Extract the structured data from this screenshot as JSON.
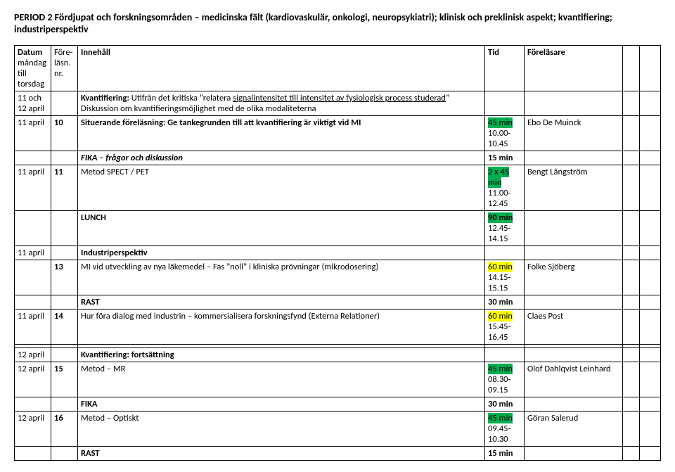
{
  "title": "PERIOD 2 Fördjupat och forskningsområden – medicinska fält (kardiovaskulär, onkologi, neuropsykiatri); klinisk och preklinisk aspekt; kvantifiering; industriperspektiv",
  "head": {
    "datum": "Datum",
    "datum_sub": "måndag till torsdag",
    "nr": "Före-läsn. nr.",
    "innehall": "Innehåll",
    "tid": "Tid",
    "forelasare": "Föreläsare"
  },
  "rows": {
    "r1_date": "11 och 12 april",
    "r1_text_a": "Kvantifiering:",
    "r1_text_b": " Utifrån det kritiska ”relatera ",
    "r1_text_underline": "signalintensitet till intensitet av fysiologisk process studerad",
    "r1_text_c": "” Diskussion om kvantifieringsmöjlighet med de olika modaliteterna",
    "r2_date": "11 april",
    "r2_nr": "10",
    "r2_text": "Situerande föreläsning: Ge tankegrunden till att kvantifiering är viktigt vid MI",
    "r2_tid1": "45 min",
    "r2_tid2": "10.00-10.45",
    "r2_fore": "Ebo De Muinck",
    "r3_text": "FIKA – frågor och diskussion",
    "r3_tid": "15 min",
    "r4_date": "11 april",
    "r4_nr": "11",
    "r4_text": "Metod SPECT / PET",
    "r4_tid1": "2 x 45 min",
    "r4_tid2": "11.00-12.45",
    "r4_fore": "Bengt Långström",
    "r5_text": "LUNCH",
    "r5_tid1": "90 min",
    "r5_tid2": "12.45-14.15",
    "r6_date": "11 april",
    "r6_text": "Industriperspektiv",
    "r7_nr": "13",
    "r7_text": "MI vid utveckling av nya läkemedel – Fas ”noll” i kliniska prövningar (mikrodosering)",
    "r7_tid1": "60 min",
    "r7_tid2": "14.15-15.15",
    "r7_fore": "Folke Sjöberg",
    "r8_text": "RAST",
    "r8_tid": "30 min",
    "r9_date": "11 april",
    "r9_nr": "14",
    "r9_text": "Hur föra dialog med industrin – kommersialisera forskningsfynd (Externa Relationer)",
    "r9_tid1": "60 min",
    "r9_tid2": "15.45-16.45",
    "r9_fore": "Claes Post",
    "r10_date": "12 april",
    "r10_text": "Kvantifiering: fortsättning",
    "r11_date": "12 april",
    "r11_nr": "15",
    "r11_text": "Metod – MR",
    "r11_tid1": "45 min",
    "r11_tid2": "08.30-09.15",
    "r11_fore": "Olof Dahlqvist Leinhard",
    "r12_text": "FIKA",
    "r12_tid": "30 min",
    "r13_date": "12 april",
    "r13_nr": "16",
    "r13_text": "Metod – Optiskt",
    "r13_tid1": "45 min",
    "r13_tid2": "09.45-10.30",
    "r13_fore": "Göran Salerud",
    "r14_text": "RAST",
    "r14_tid": "15 min"
  }
}
